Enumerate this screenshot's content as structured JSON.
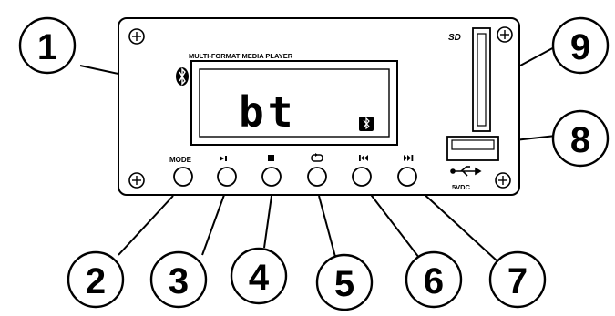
{
  "panel": {
    "title": "MULTI-FORMAT MEDIA PLAYER",
    "display_text": "bt",
    "sd_logo": "SD",
    "usb_label": "5VDC"
  },
  "buttons": [
    {
      "id": "mode",
      "label": "MODE",
      "icon": "text"
    },
    {
      "id": "play-pause",
      "label": "",
      "icon": "play-pause-icon"
    },
    {
      "id": "stop",
      "label": "",
      "icon": "stop-icon"
    },
    {
      "id": "repeat",
      "label": "",
      "icon": "repeat-icon"
    },
    {
      "id": "previous",
      "label": "",
      "icon": "previous-icon"
    },
    {
      "id": "next",
      "label": "",
      "icon": "next-icon"
    }
  ],
  "callouts": [
    {
      "number": "1",
      "target": "display"
    },
    {
      "number": "2",
      "target": "mode-button"
    },
    {
      "number": "3",
      "target": "play-pause-button"
    },
    {
      "number": "4",
      "target": "stop-button"
    },
    {
      "number": "5",
      "target": "repeat-button"
    },
    {
      "number": "6",
      "target": "previous-button"
    },
    {
      "number": "7",
      "target": "next-button"
    },
    {
      "number": "8",
      "target": "usb-port"
    },
    {
      "number": "9",
      "target": "sd-slot"
    }
  ]
}
